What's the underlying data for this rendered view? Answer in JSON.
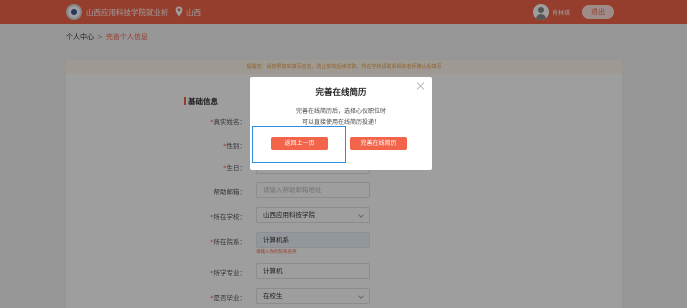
{
  "colors": {
    "brand": "#f3654a",
    "focus": "#2c8fe0",
    "notice_text": "#e8a14a"
  },
  "header": {
    "site_title": "山西应用科技学院就业析",
    "location": "山西",
    "username": "肖林琪",
    "logout_label": "退出"
  },
  "breadcrumb": {
    "home": "个人中心",
    "separator": ">",
    "current": "完善个人信息"
  },
  "form": {
    "notice": "提醒您：请按照如实填写信息，防止影响后续求职，所在学校请联系相关老师确认后填写",
    "section_title": "基础信息",
    "rows": [
      {
        "label": "真实姓名：",
        "required": true,
        "value": ""
      },
      {
        "label": "性别：",
        "required": true,
        "value": ""
      },
      {
        "label": "生日：",
        "required": true,
        "value": ""
      },
      {
        "label": "帮助邮箱：",
        "required": false,
        "value": "",
        "placeholder": "请输入帮助邮箱地址"
      },
      {
        "label": "所在学校：",
        "required": true,
        "value": "山西应用科技学院"
      },
      {
        "label": "所在院系：",
        "required": true,
        "value": "计算机系",
        "hint": "请输入你的院系名称"
      },
      {
        "label": "所学专业：",
        "required": true,
        "value": "计算机"
      },
      {
        "label": "是否毕业：",
        "required": true,
        "value": "在校生"
      }
    ]
  },
  "modal": {
    "title": "完善在线简历",
    "line1": "完善在线简历后，选择心仪职位时",
    "line2": "可以直接使用在线简历投递！",
    "back_button": "返回上一页",
    "complete_button": "完善在线简历"
  }
}
